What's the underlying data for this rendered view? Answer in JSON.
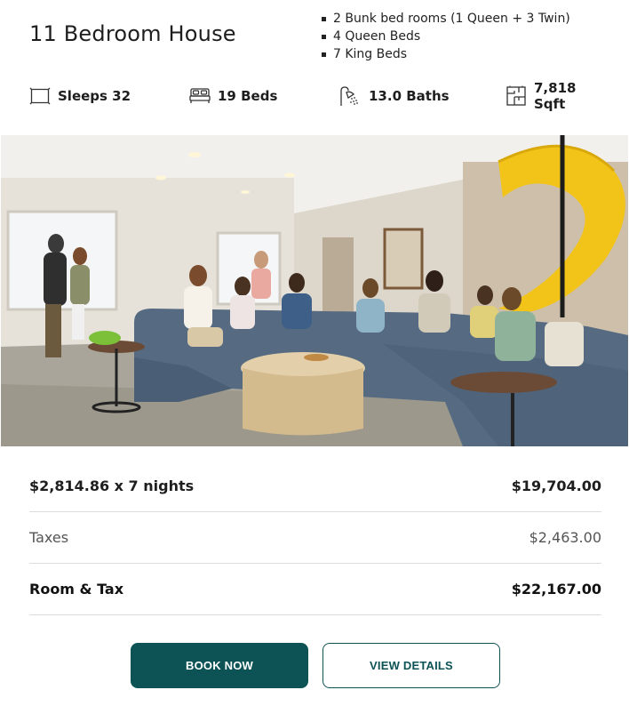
{
  "listing": {
    "title": "11 Bedroom House",
    "bed_details": [
      "2 Bunk bed rooms (1 Queen + 3 Twin)",
      "4 Queen Beds",
      "7 King Beds"
    ],
    "amenities": {
      "sleeps": {
        "label": "Sleeps 32",
        "icon": "bed-frame-icon"
      },
      "beds": {
        "label": "19 Beds",
        "icon": "bed-icon"
      },
      "baths": {
        "label": "13.0 Baths",
        "icon": "shower-icon"
      },
      "sqft": {
        "label": "7,818 Sqft",
        "icon": "floor-plan-icon"
      }
    }
  },
  "photo": {
    "subject": "family-room-with-yellow-slide"
  },
  "pricing": {
    "nightly": {
      "label": "$2,814.86 x 7 nights",
      "amount": "$19,704.00"
    },
    "taxes": {
      "label": "Taxes",
      "amount": "$2,463.00"
    },
    "total": {
      "label": "Room & Tax",
      "amount": "$22,167.00"
    }
  },
  "actions": {
    "book_label": "BOOK NOW",
    "details_label": "VIEW DETAILS"
  },
  "colors": {
    "accent": "#0d5356",
    "divider": "#dcdcdc",
    "slide": "#f2c318"
  }
}
